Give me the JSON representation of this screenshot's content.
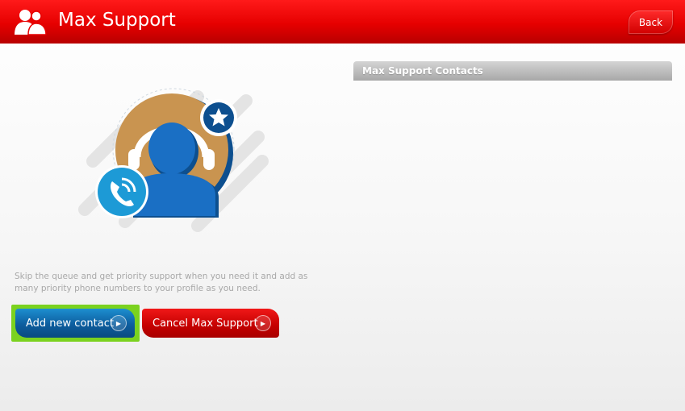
{
  "header": {
    "title": "Max Support",
    "icon": "users-icon",
    "back_label": "Back",
    "bg_color": "#e60000"
  },
  "main": {
    "illustration_icon": "support-agent-headset-icon",
    "description": "Skip the queue and get priority support when you need it and add as many priority phone numbers to your profile as you need.",
    "add_contact_label": "Add new contact",
    "cancel_label": "Cancel Max Support"
  },
  "contacts_panel": {
    "title": "Max Support Contacts"
  },
  "colors": {
    "primary_red": "#e60000",
    "button_blue": "#0d5d9e",
    "highlight_green": "#7bd21f"
  }
}
